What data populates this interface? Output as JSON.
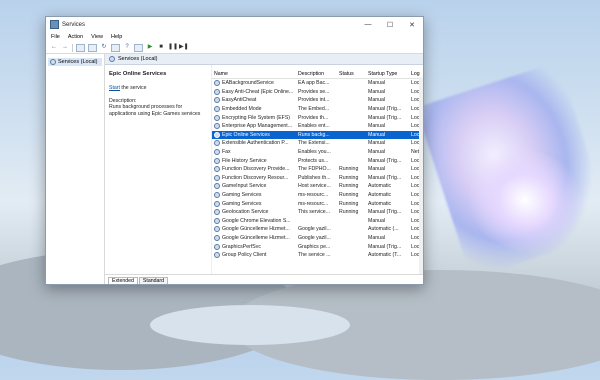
{
  "window": {
    "title": "Services",
    "controls": {
      "minimize": "—",
      "maximize": "☐",
      "close": "✕"
    }
  },
  "menu": [
    "File",
    "Action",
    "View",
    "Help"
  ],
  "toolbar_icons": [
    "back-arrow-icon",
    "forward-arrow-icon",
    "console-tree-icon",
    "properties-icon",
    "refresh-icon",
    "export-icon",
    "help-icon",
    "play-icon",
    "stop-icon",
    "pause-icon",
    "restart-icon"
  ],
  "tree": {
    "root": "Services (Local)"
  },
  "header": {
    "label": "Services (Local)"
  },
  "detail": {
    "service_name": "Epic Online Services",
    "start_link": "Start",
    "start_suffix": " the service",
    "description_label": "Description:",
    "description": "Runs background processes for applications using Epic Games services"
  },
  "columns": {
    "name": "Name",
    "description": "Description",
    "status": "Status",
    "startup": "Startup Type",
    "logon": "Log"
  },
  "services": [
    {
      "name": "EABackgroundService",
      "desc": "EA app Bac...",
      "status": "",
      "startup": "Manual",
      "logon": "Loc"
    },
    {
      "name": "Easy Anti-Cheat (Epic Online...",
      "desc": "Provides se...",
      "status": "",
      "startup": "Manual",
      "logon": "Loc"
    },
    {
      "name": "EasyAntiCheat",
      "desc": "Provides int...",
      "status": "",
      "startup": "Manual",
      "logon": "Loc"
    },
    {
      "name": "Embedded Mode",
      "desc": "The Embed...",
      "status": "",
      "startup": "Manual (Trig...",
      "logon": "Loc"
    },
    {
      "name": "Encrypting File System (EFS)",
      "desc": "Provides th...",
      "status": "",
      "startup": "Manual (Trig...",
      "logon": "Loc"
    },
    {
      "name": "Enterprise App Management...",
      "desc": "Enables ent...",
      "status": "",
      "startup": "Manual",
      "logon": "Loc"
    },
    {
      "name": "Epic Online Services",
      "desc": "Runs backg...",
      "status": "",
      "startup": "Manual",
      "logon": "Loc"
    },
    {
      "name": "Extensible Authentication P...",
      "desc": "The Extensi...",
      "status": "",
      "startup": "Manual",
      "logon": "Loc"
    },
    {
      "name": "Fax",
      "desc": "Enables you...",
      "status": "",
      "startup": "Manual",
      "logon": "Net"
    },
    {
      "name": "File History Service",
      "desc": "Protects us...",
      "status": "",
      "startup": "Manual (Trig...",
      "logon": "Loc"
    },
    {
      "name": "Function Discovery Provide...",
      "desc": "The FDPHO...",
      "status": "Running",
      "startup": "Manual",
      "logon": "Loc"
    },
    {
      "name": "Function Discovery Resour...",
      "desc": "Publishes th...",
      "status": "Running",
      "startup": "Manual (Trig...",
      "logon": "Loc"
    },
    {
      "name": "GameInput Service",
      "desc": "Host service...",
      "status": "Running",
      "startup": "Automatic",
      "logon": "Loc"
    },
    {
      "name": "Gaming Services",
      "desc": "ms-resourc...",
      "status": "Running",
      "startup": "Automatic",
      "logon": "Loc"
    },
    {
      "name": "Gaming Services",
      "desc": "ms-resourc...",
      "status": "Running",
      "startup": "Automatic",
      "logon": "Loc"
    },
    {
      "name": "Geolocation Service",
      "desc": "This service...",
      "status": "Running",
      "startup": "Manual (Trig...",
      "logon": "Loc"
    },
    {
      "name": "Google Chrome Elevation S...",
      "desc": "",
      "status": "",
      "startup": "Manual",
      "logon": "Loc"
    },
    {
      "name": "Google Güncelleme Hizmet...",
      "desc": "Google yazil...",
      "status": "",
      "startup": "Automatic (...",
      "logon": "Loc"
    },
    {
      "name": "Google Güncelleme Hizmet...",
      "desc": "Google yazil...",
      "status": "",
      "startup": "Manual",
      "logon": "Loc"
    },
    {
      "name": "GraphicsPerfSvc",
      "desc": "Graphics pe...",
      "status": "",
      "startup": "Manual (Trig...",
      "logon": "Loc"
    },
    {
      "name": "Group Policy Client",
      "desc": "The service ...",
      "status": "",
      "startup": "Automatic (T...",
      "logon": "Loc"
    }
  ],
  "selected_index": 6,
  "tabs": [
    "Extended",
    "Standard"
  ]
}
